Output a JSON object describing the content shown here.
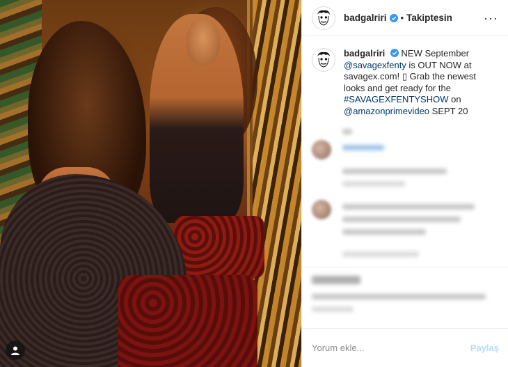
{
  "header": {
    "username": "badgalriri",
    "separator": "•",
    "follow_state": "Takiptesin",
    "more_label": "···"
  },
  "caption": {
    "username": "badgalriri",
    "text_1": "NEW September ",
    "mention_1": "@savagexfenty",
    "text_2": " is OUT NOW at savagex.com! ",
    "emoji_glyph": "▯",
    "text_3": " Grab the newest looks and get ready for the ",
    "hashtag": "#SAVAGEXFENTYSHOW",
    "text_4": " on ",
    "mention_2": "@amazonprimevideo",
    "text_5": " SEPT 20"
  },
  "comment_form": {
    "placeholder": "Yorum ekle...",
    "post_label": "Paylaş"
  },
  "colors": {
    "verified": "#3897f0",
    "link": "#00376b",
    "post_disabled": "#b2dffc",
    "border": "#efefef"
  },
  "icons": {
    "verified": "verified-badge-icon",
    "media_user": "user-tag-icon",
    "more": "more-options-icon"
  }
}
